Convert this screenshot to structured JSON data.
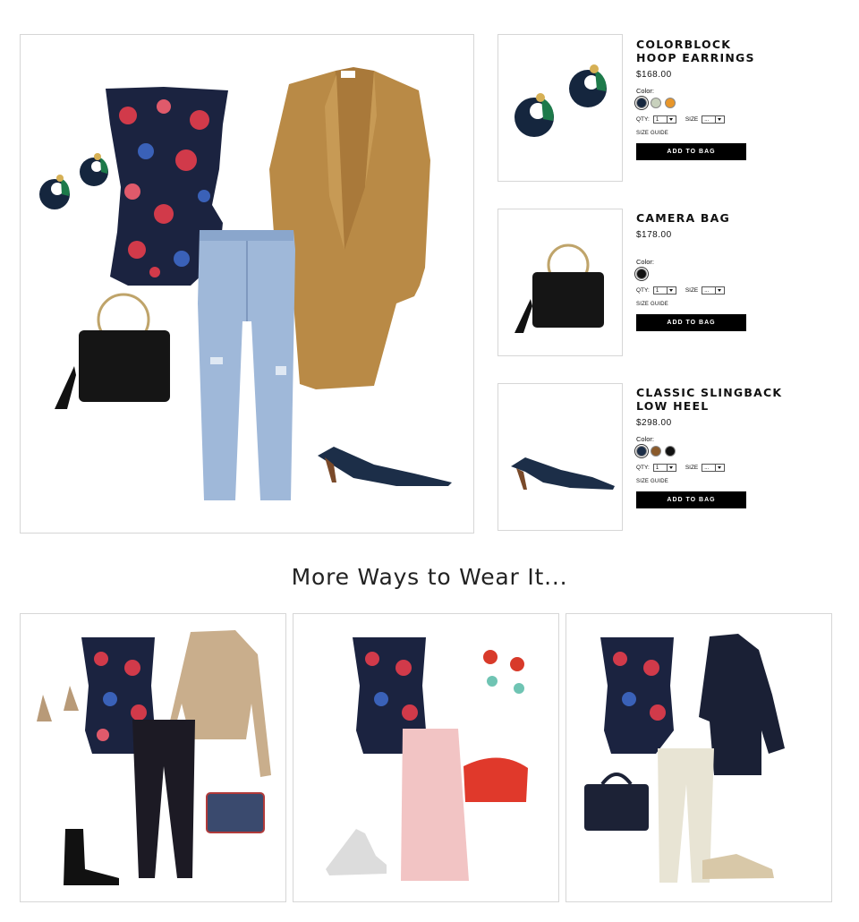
{
  "products": [
    {
      "name_line1": "COLORBLOCK",
      "name_line2": "HOOP EARRINGS",
      "price": "$168.00",
      "color_label": "Color:",
      "colors": [
        "#15263e",
        "#c8d1bd",
        "#e8962a"
      ],
      "qty_label": "QTY:",
      "qty_value": "1",
      "size_label": "SIZE",
      "size_value": "...",
      "size_guide": "SIZE GUIDE",
      "button": "ADD TO BAG"
    },
    {
      "name_line1": "CAMERA BAG",
      "name_line2": "",
      "price": "$178.00",
      "color_label": "Color:",
      "colors": [
        "#111111"
      ],
      "qty_label": "QTY:",
      "qty_value": "1",
      "size_label": "SIZE",
      "size_value": "...",
      "size_guide": "SIZE GUIDE",
      "button": "ADD TO BAG"
    },
    {
      "name_line1": "CLASSIC SLINGBACK",
      "name_line2": "LOW HEEL",
      "price": "$298.00",
      "color_label": "Color:",
      "colors": [
        "#1c2e48",
        "#8a5a2b",
        "#111111"
      ],
      "qty_label": "QTY:",
      "qty_value": "1",
      "size_label": "SIZE",
      "size_value": "...",
      "size_guide": "SIZE GUIDE",
      "button": "ADD TO BAG"
    }
  ],
  "more_heading": "More Ways to Wear It...",
  "colors": {
    "accent_button": "#000000",
    "border": "#d6d6d6",
    "camel": "#b98a46",
    "denim": "#9fb8d9",
    "navy": "#1b2340",
    "floral_red": "#d13a4a"
  }
}
